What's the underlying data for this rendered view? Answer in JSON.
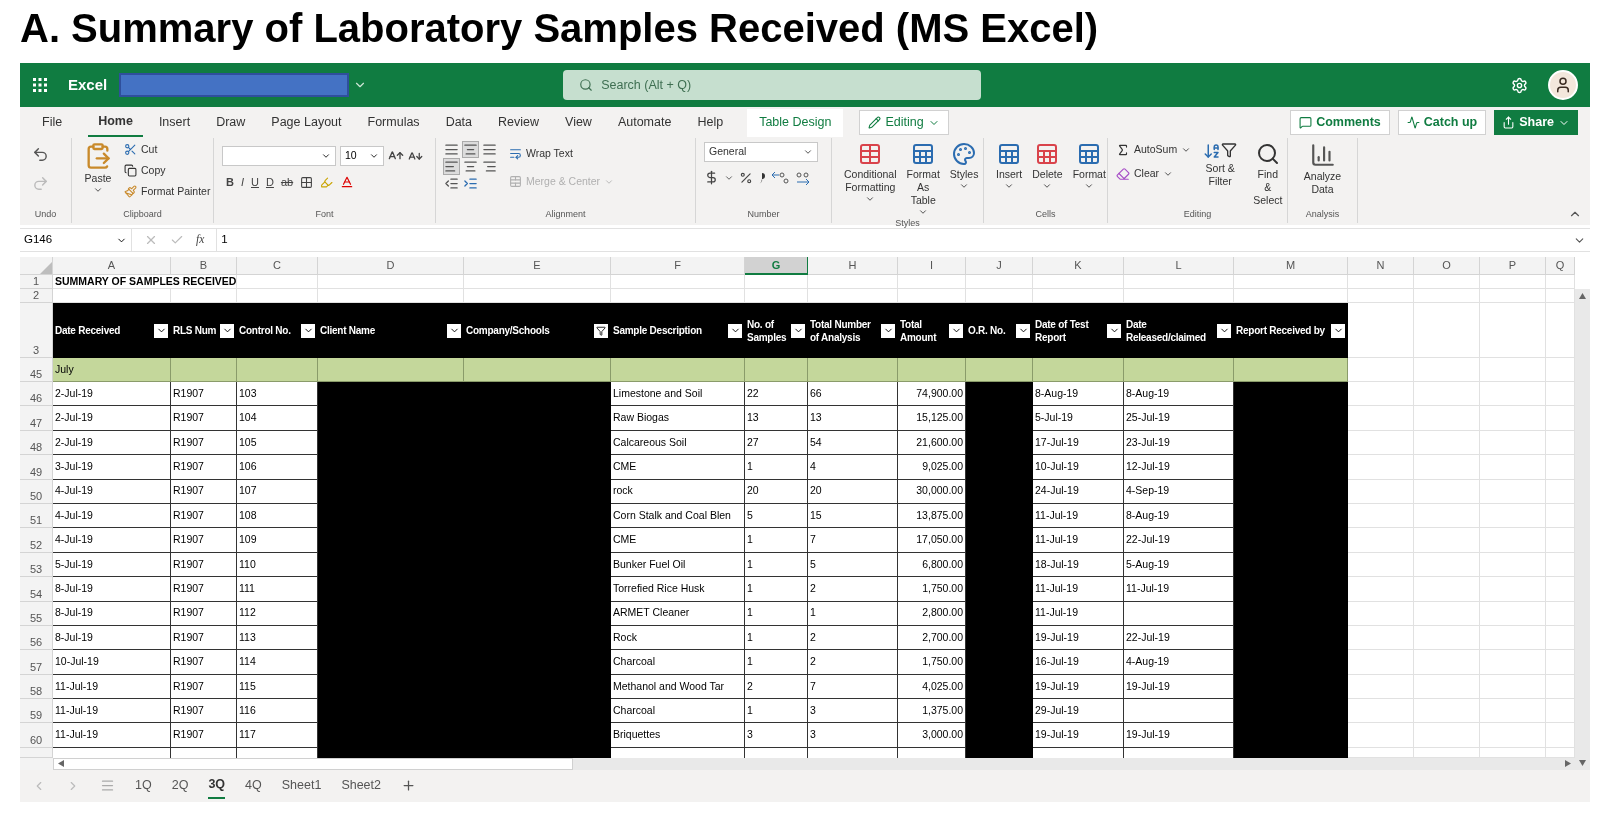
{
  "heading": "A. Summary of Laboratory Samples Received (MS Excel)",
  "app": {
    "name": "Excel",
    "search_placeholder": "Search (Alt + Q)"
  },
  "menu_tabs": [
    {
      "label": "File",
      "selected": false,
      "kind": "normal"
    },
    {
      "label": "Home",
      "selected": true,
      "kind": "normal"
    },
    {
      "label": "Insert",
      "selected": false,
      "kind": "normal"
    },
    {
      "label": "Draw",
      "selected": false,
      "kind": "normal"
    },
    {
      "label": "Page Layout",
      "selected": false,
      "kind": "normal"
    },
    {
      "label": "Formulas",
      "selected": false,
      "kind": "normal"
    },
    {
      "label": "Data",
      "selected": false,
      "kind": "normal"
    },
    {
      "label": "Review",
      "selected": false,
      "kind": "normal"
    },
    {
      "label": "View",
      "selected": false,
      "kind": "normal"
    },
    {
      "label": "Automate",
      "selected": false,
      "kind": "normal"
    },
    {
      "label": "Help",
      "selected": false,
      "kind": "normal"
    },
    {
      "label": "Table Design",
      "selected": false,
      "kind": "contextual"
    }
  ],
  "mode_button": "Editing",
  "actions": [
    {
      "label": "Comments",
      "kind": "outline"
    },
    {
      "label": "Catch up",
      "kind": "outline"
    },
    {
      "label": "Share",
      "kind": "primary"
    }
  ],
  "ribbon": {
    "undo": {
      "label": "Undo"
    },
    "clipboard": {
      "label": "Clipboard",
      "paste": "Paste",
      "cut": "Cut",
      "copy": "Copy",
      "format_painter": "Format Painter"
    },
    "font": {
      "label": "Font",
      "size": "10",
      "buttons": [
        "B",
        "I",
        "U",
        "D",
        "ab"
      ]
    },
    "alignment": {
      "label": "Alignment",
      "wrap_text": "Wrap Text",
      "merge_center": "Merge & Center",
      "merge_disabled": true
    },
    "number": {
      "label": "Number",
      "format": "General"
    },
    "styles": {
      "label": "Styles",
      "items": [
        "Conditional Formatting",
        "Format As Table",
        "Styles"
      ]
    },
    "cells": {
      "label": "Cells",
      "items": [
        "Insert",
        "Delete",
        "Format"
      ]
    },
    "editing": {
      "label": "Editing",
      "autosum": "AutoSum",
      "clear": "Clear",
      "sort": "Sort & Filter",
      "find": "Find & Select"
    },
    "analysis": {
      "label": "Analysis",
      "items": [
        "Analyze Data"
      ]
    }
  },
  "formula_bar": {
    "name_box": "G146",
    "fx": "fx",
    "value": "1"
  },
  "columns": [
    {
      "letter": "A",
      "selected": false
    },
    {
      "letter": "B",
      "selected": false
    },
    {
      "letter": "C",
      "selected": false
    },
    {
      "letter": "D",
      "selected": false
    },
    {
      "letter": "E",
      "selected": false
    },
    {
      "letter": "F",
      "selected": false
    },
    {
      "letter": "G",
      "selected": true
    },
    {
      "letter": "H",
      "selected": false
    },
    {
      "letter": "I",
      "selected": false
    },
    {
      "letter": "J",
      "selected": false
    },
    {
      "letter": "K",
      "selected": false
    },
    {
      "letter": "L",
      "selected": false
    },
    {
      "letter": "M",
      "selected": false
    },
    {
      "letter": "N",
      "selected": false
    },
    {
      "letter": "O",
      "selected": false
    },
    {
      "letter": "P",
      "selected": false
    },
    {
      "letter": "Q",
      "selected": false
    }
  ],
  "sheet_title": {
    "row": "1",
    "text": "SUMMARY OF SAMPLES RECEIVED"
  },
  "empty_row": "2",
  "header_row": "3",
  "headers": [
    {
      "text": "Date Received",
      "filtered": false,
      "redacted": false,
      "numeric": false
    },
    {
      "text": "RLS Num",
      "filtered": false,
      "redacted": false,
      "numeric": false
    },
    {
      "text": "Control No.",
      "filtered": false,
      "redacted": false,
      "numeric": false
    },
    {
      "text": "Client Name",
      "filtered": false,
      "redacted": true,
      "numeric": false
    },
    {
      "text": "Company/Schools",
      "filtered": true,
      "redacted": true,
      "numeric": false
    },
    {
      "text": "Sample Description",
      "filtered": false,
      "redacted": false,
      "numeric": false
    },
    {
      "text": "No. of Samples",
      "filtered": false,
      "redacted": false,
      "numeric": false
    },
    {
      "text": "Total Number of Analysis",
      "filtered": false,
      "redacted": false,
      "numeric": false
    },
    {
      "text": "Total Amount",
      "filtered": false,
      "redacted": false,
      "numeric": true
    },
    {
      "text": "O.R. No.",
      "filtered": false,
      "redacted": true,
      "numeric": false
    },
    {
      "text": "Date of Test Report",
      "filtered": false,
      "redacted": false,
      "numeric": false
    },
    {
      "text": "Date Released/claimed",
      "filtered": false,
      "redacted": false,
      "numeric": false
    },
    {
      "text": "Report Received by",
      "filtered": false,
      "redacted": true,
      "numeric": false
    }
  ],
  "rows": [
    {
      "num": "45",
      "kind": "group",
      "cells": [
        "July"
      ]
    },
    {
      "num": "46",
      "kind": "data",
      "cells": [
        "2-Jul-19",
        "R1907",
        "103",
        "Limestone and Soil",
        "22",
        "66",
        "74,900.00",
        "8-Aug-19",
        "8-Aug-19"
      ]
    },
    {
      "num": "47",
      "kind": "data",
      "cells": [
        "2-Jul-19",
        "R1907",
        "104",
        "Raw Biogas",
        "13",
        "13",
        "15,125.00",
        "5-Jul-19",
        "25-Jul-19"
      ]
    },
    {
      "num": "48",
      "kind": "data",
      "cells": [
        "2-Jul-19",
        "R1907",
        "105",
        "Calcareous Soil",
        "27",
        "54",
        "21,600.00",
        "17-Jul-19",
        "23-Jul-19"
      ]
    },
    {
      "num": "49",
      "kind": "data",
      "cells": [
        "3-Jul-19",
        "R1907",
        "106",
        "CME",
        "1",
        "4",
        "9,025.00",
        "10-Jul-19",
        "12-Jul-19"
      ]
    },
    {
      "num": "50",
      "kind": "data",
      "cells": [
        "4-Jul-19",
        "R1907",
        "107",
        "rock",
        "20",
        "20",
        "30,000.00",
        "24-Jul-19",
        "4-Sep-19"
      ]
    },
    {
      "num": "51",
      "kind": "data",
      "cells": [
        "4-Jul-19",
        "R1907",
        "108",
        "Corn Stalk and Coal Blen",
        "5",
        "15",
        "13,875.00",
        "11-Jul-19",
        "8-Aug-19"
      ]
    },
    {
      "num": "52",
      "kind": "data",
      "cells": [
        "4-Jul-19",
        "R1907",
        "109",
        "CME",
        "1",
        "7",
        "17,050.00",
        "11-Jul-19",
        "22-Jul-19"
      ]
    },
    {
      "num": "53",
      "kind": "data",
      "cells": [
        "5-Jul-19",
        "R1907",
        "110",
        "Bunker Fuel Oil",
        "1",
        "5",
        "6,800.00",
        "18-Jul-19",
        "5-Aug-19"
      ]
    },
    {
      "num": "54",
      "kind": "data",
      "cells": [
        "8-Jul-19",
        "R1907",
        "111",
        "Torrefied Rice Husk",
        "1",
        "2",
        "1,750.00",
        "11-Jul-19",
        "11-Jul-19"
      ]
    },
    {
      "num": "55",
      "kind": "data",
      "cells": [
        "8-Jul-19",
        "R1907",
        "112",
        "ARMET Cleaner",
        "1",
        "1",
        "2,800.00",
        "11-Jul-19"
      ]
    },
    {
      "num": "56",
      "kind": "data",
      "cells": [
        "8-Jul-19",
        "R1907",
        "113",
        "Rock",
        "1",
        "2",
        "2,700.00",
        "19-Jul-19",
        "22-Jul-19"
      ]
    },
    {
      "num": "57",
      "kind": "data",
      "cells": [
        "10-Jul-19",
        "R1907",
        "114",
        "Charcoal",
        "1",
        "2",
        "1,750.00",
        "16-Jul-19",
        "4-Aug-19"
      ]
    },
    {
      "num": "58",
      "kind": "data",
      "cells": [
        "11-Jul-19",
        "R1907",
        "115",
        "Methanol and Wood Tar",
        "2",
        "7",
        "4,025.00",
        "19-Jul-19",
        "19-Jul-19"
      ]
    },
    {
      "num": "59",
      "kind": "data",
      "cells": [
        "11-Jul-19",
        "R1907",
        "116",
        "Charcoal",
        "1",
        "3",
        "1,375.00",
        "29-Jul-19"
      ]
    },
    {
      "num": "60",
      "kind": "data",
      "cells": [
        "11-Jul-19",
        "R1907",
        "117",
        "Briquettes",
        "3",
        "3",
        "3,000.00",
        "19-Jul-19",
        "19-Jul-19"
      ]
    }
  ],
  "sheet_tabs": [
    {
      "label": "1Q",
      "selected": false
    },
    {
      "label": "2Q",
      "selected": false
    },
    {
      "label": "3Q",
      "selected": true
    },
    {
      "label": "4Q",
      "selected": false
    },
    {
      "label": "Sheet1",
      "selected": false
    },
    {
      "label": "Sheet2",
      "selected": false
    }
  ]
}
